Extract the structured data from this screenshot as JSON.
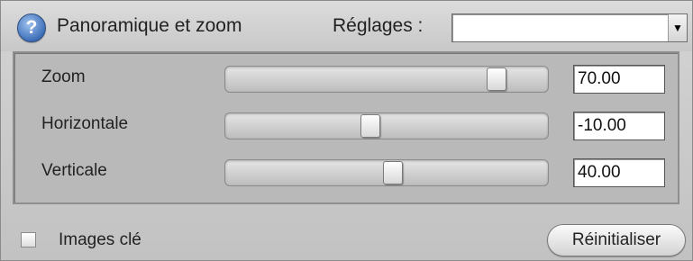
{
  "header": {
    "help_icon": "help-icon",
    "help_label": "?",
    "title": "Panoramique et zoom",
    "settings_label": "Réglages :",
    "settings_value": "",
    "dropdown_arrow": "▼"
  },
  "sliders": [
    {
      "label": "Zoom",
      "value": "70.00",
      "position": 0.84
    },
    {
      "label": "Horizontale",
      "value": "-10.00",
      "position": 0.45
    },
    {
      "label": "Verticale",
      "value": "40.00",
      "position": 0.52
    }
  ],
  "footer": {
    "checkbox_label": "Images clé",
    "checkbox_checked": false,
    "reset_label": "Réinitialiser"
  }
}
